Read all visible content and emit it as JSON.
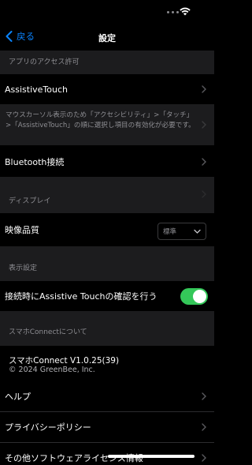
{
  "nav": {
    "back_label": "戻る",
    "title": "設定"
  },
  "sections": {
    "access": "アプリのアクセス許可",
    "display": "ディスプレイ",
    "view": "表示設定",
    "about": "スマホConnectについて"
  },
  "rows": {
    "assistive_touch": "AssistiveTouch",
    "note": "マウスカーソル表示のため「アクセシビリティ」>「タッチ」>「AssistiveTouch」の順に選択し項目の有効化が必要です。",
    "bluetooth": "Bluetooth接続",
    "video_quality": "映像品質",
    "video_quality_value": "標準",
    "confirm_assistive": "接続時にAssistive Touchの確認を行う",
    "confirm_assistive_enabled": true,
    "help": "ヘルプ",
    "privacy": "プライバシーポリシー",
    "licenses": "その他ソフトウェアライセンス情報"
  },
  "about": {
    "app_version": "スマホConnect V1.0.25(39)",
    "copyright": "© 2024 GreenBee, Inc."
  },
  "colors": {
    "accent": "#0a84ff",
    "toggle_on": "#34c759",
    "section_bg": "#1c1c1e",
    "secondary_text": "#8e8e93"
  }
}
